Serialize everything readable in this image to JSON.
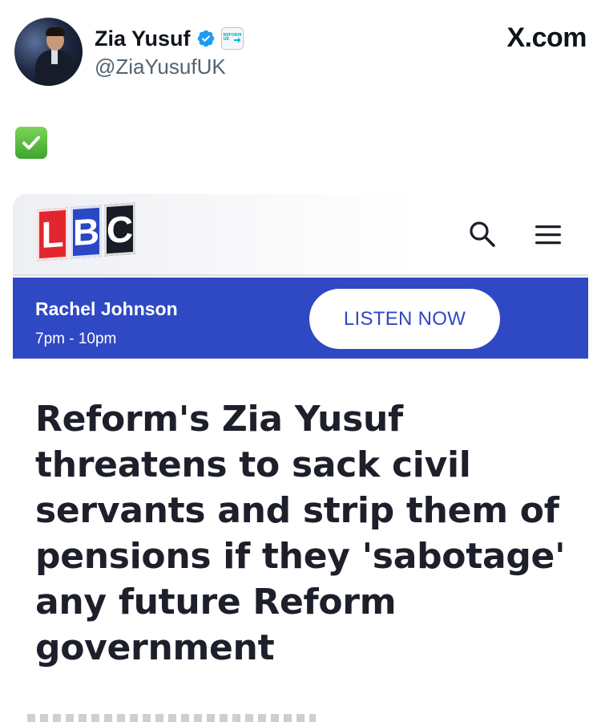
{
  "tweet": {
    "author": {
      "name": "Zia Yusuf",
      "handle": "@ZiaYusufUK",
      "verified": true,
      "affiliate_badge_text": "REFORM UK"
    },
    "platform_label": "X.com",
    "text_emoji": "✅"
  },
  "lbc": {
    "logo_letters": [
      "L",
      "B",
      "C"
    ],
    "colors": {
      "logo_l": "#e2262e",
      "logo_b": "#2a47c4",
      "logo_c": "#1a1c25",
      "live_bar": "#2f48c4",
      "headline": "#1d1f2a"
    },
    "header_icons": [
      "search-icon",
      "hamburger-menu-icon"
    ],
    "live_bar": {
      "presenter": "Rachel Johnson",
      "time": "7pm - 10pm",
      "button_label": "LISTEN NOW"
    },
    "headline_lines": [
      "Reform's Zia Yusuf",
      "threatens to sack civil",
      "servants and strip them of",
      "pensions if they 'sabotage'",
      "any future Reform",
      "government"
    ]
  }
}
